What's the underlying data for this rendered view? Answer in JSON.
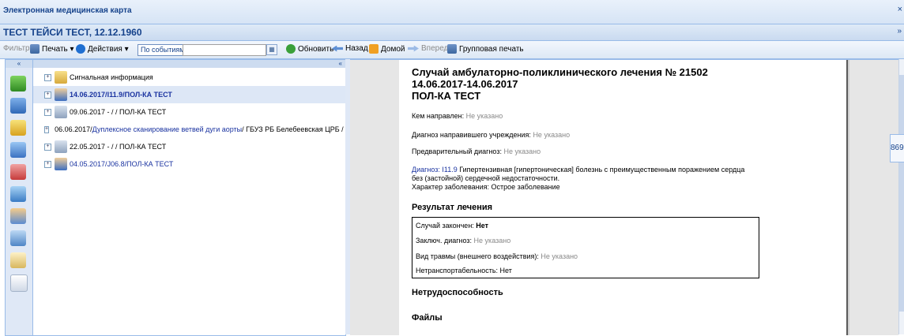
{
  "window": {
    "title": "Электронная медицинская карта",
    "close_glyph": "×"
  },
  "patient": {
    "name": "ТЕСТ ТЕЙСИ ТЕСТ, 12.12.1960",
    "collapse_glyph": "»"
  },
  "toolbar": {
    "filters_label": "Фильтры",
    "print_label": "Печать ▾",
    "actions_label": "Действия ▾",
    "by_events_label": "По событиям",
    "filter_value": "",
    "calendar_glyph": "▦",
    "refresh_label": "Обновить",
    "back_label": "Назад",
    "home_label": "Домой",
    "forward_label": "Вперед",
    "group_print_label": "Групповая печать"
  },
  "sidebar": {
    "collapse_glyph": "«",
    "icons": [
      "person-green-icon",
      "calendar-icon",
      "sun-icon",
      "syringe-icon",
      "journal-icon",
      "edit-icon",
      "users-icon",
      "monitor-icon",
      "book-icon",
      "mail-icon"
    ]
  },
  "tree": {
    "collapse_glyph": "«",
    "rows": [
      {
        "text": "Сигнальная информация"
      },
      {
        "date": "14.06.2017",
        "sep1": " / ",
        "code": "I11.9",
        "sep2": " / ",
        "doc": "ПОЛ-КА ТЕСТ"
      },
      {
        "text": "09.06.2017 - / / ПОЛ-КА ТЕСТ"
      },
      {
        "date": "06.06.2017",
        "sep1": " / ",
        "service": "Дуплексное сканирование ветвей дуги аорты",
        "rest": " / ГБУЗ РБ Белебеевская ЦРБ / УЗИ"
      },
      {
        "text": "22.05.2017 - / / ПОЛ-КА ТЕСТ"
      },
      {
        "date": "04.05.2017",
        "sep1": " / ",
        "code": "J06.8",
        "sep2": " / ",
        "doc": "ПОЛ-КА ТЕСТ"
      }
    ]
  },
  "document": {
    "title_line1": "Случай амбулаторно-поликлинического лечения № 21502",
    "title_line2": "14.06.2017-14.06.2017",
    "title_line3": "ПОЛ-КА ТЕСТ",
    "referred_by_label": "Кем направлен: ",
    "referred_by_value": "Не указано",
    "ref_diag_label": "Диагноз направившего учреждения: ",
    "ref_diag_value": "Не указано",
    "prelim_label": "Предварительный диагноз: ",
    "prelim_value": "Не указано",
    "diag_label": "Диагноз: ",
    "diag_code": "I11.9",
    "diag_text_1": " Гипертензивная [гипертоническая] болезнь с преимущественным поражением сердца",
    "diag_text_2": "без (застойной) сердечной недостаточности.",
    "disease_nature": "Характер заболевания: Острое заболевание",
    "result_heading": "Результат лечения",
    "case_closed_label": "Случай закончен: ",
    "case_closed_value": "Нет",
    "final_diag_label": "Заключ. диагноз: ",
    "final_diag_value": "Не указано",
    "injury_label": "Вид травмы (внешнего воздействия): ",
    "injury_value": "Не указано",
    "nontransport_label": "Нетранспортабельность: ",
    "nontransport_value": "Нет",
    "disability_heading": "Нетрудоспособность",
    "files_heading": "Файлы"
  },
  "right_tab": {
    "text": "869"
  }
}
